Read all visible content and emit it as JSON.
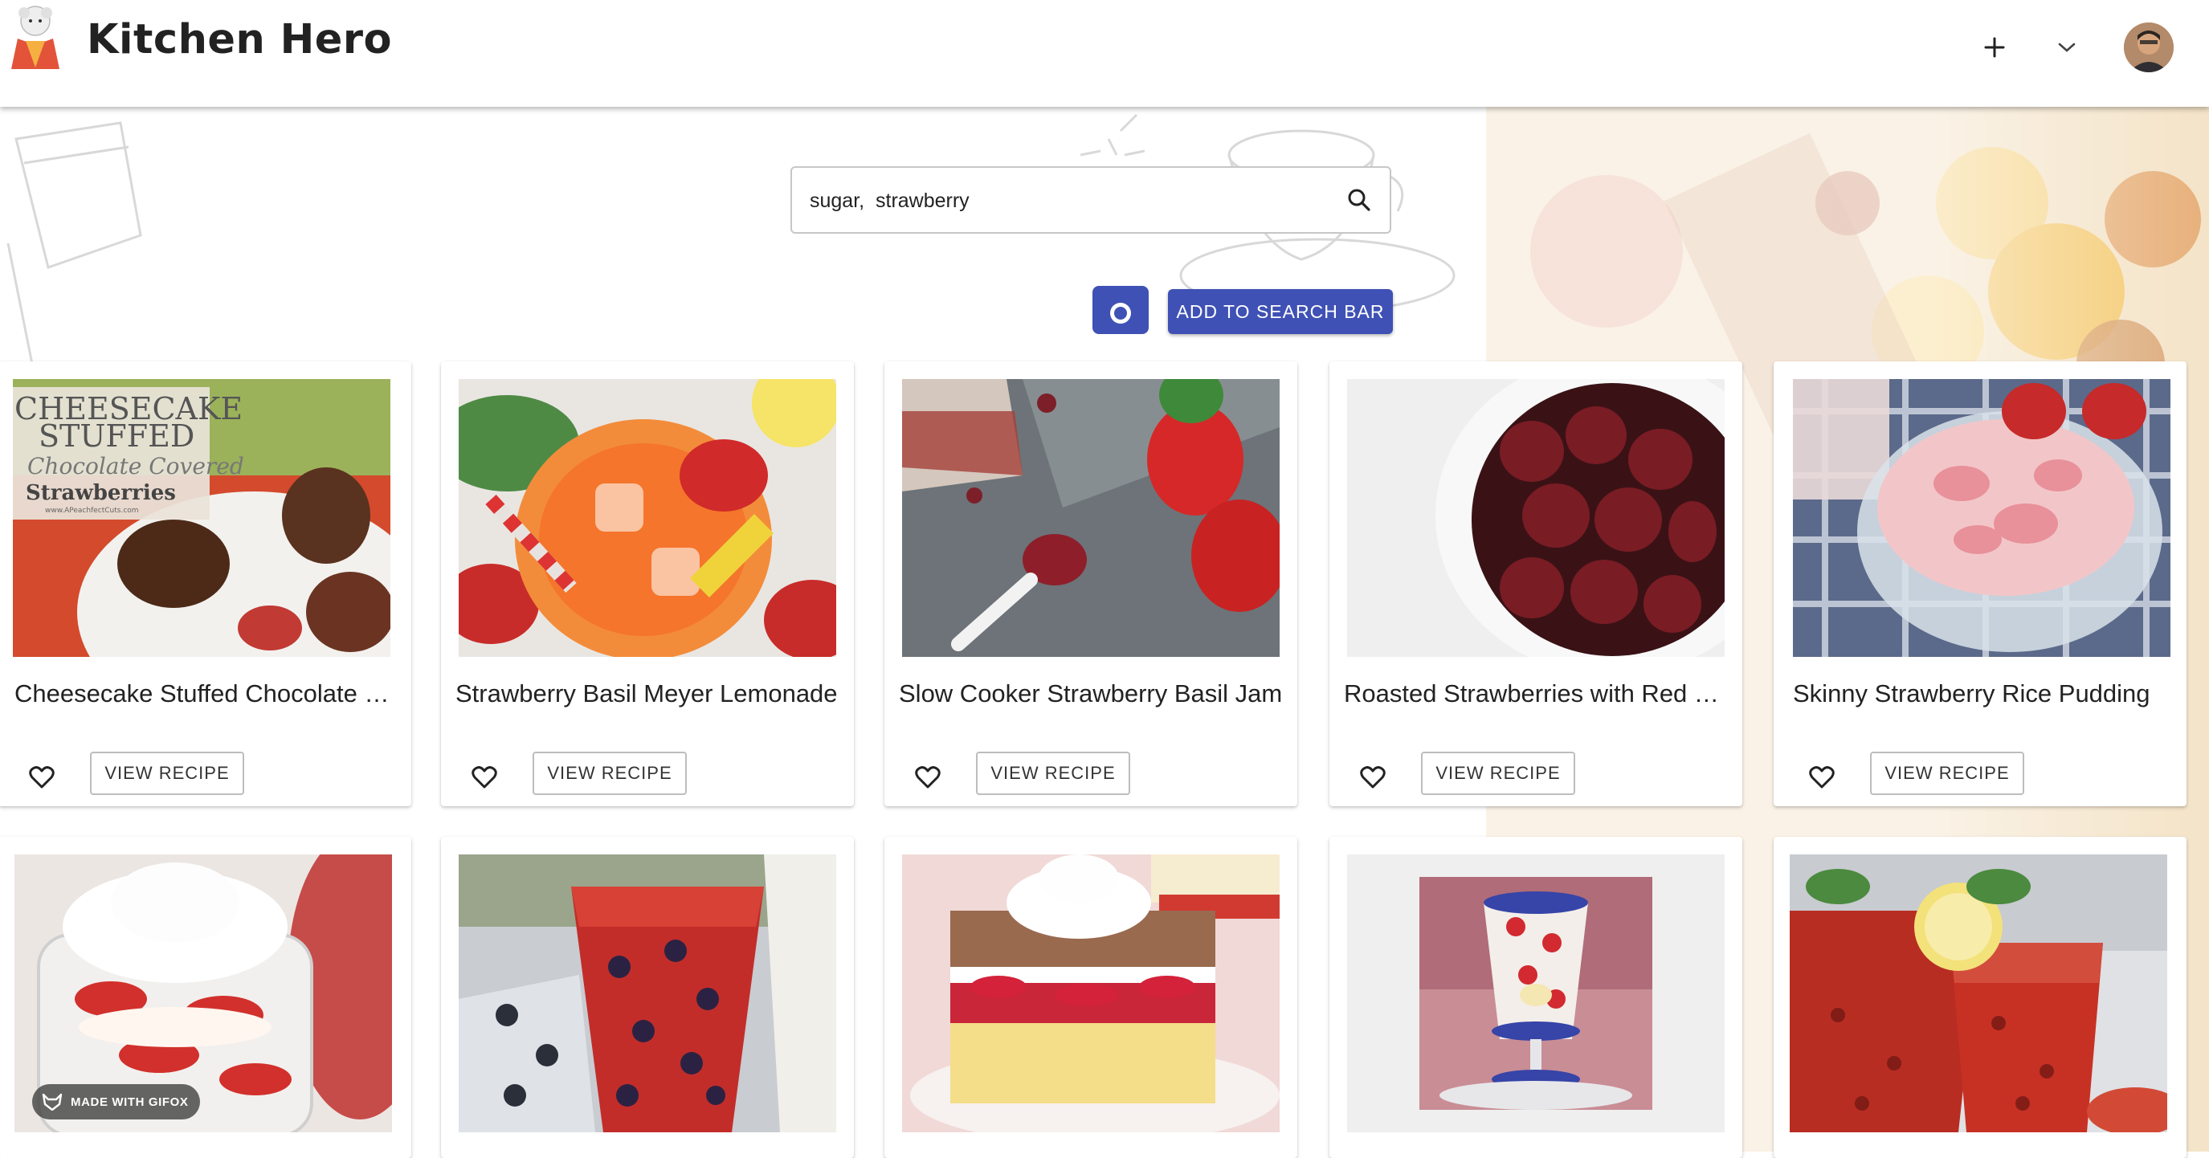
{
  "app": {
    "title": "Kitchen Hero"
  },
  "header": {
    "add_icon": "plus-icon",
    "menu_icon": "chevron-down-icon",
    "avatar": "user-avatar"
  },
  "search": {
    "value": "sugar,  strawberry",
    "icon": "search-icon"
  },
  "actions": {
    "camera_icon": "camera-icon",
    "add_label": "ADD TO SEARCH BAR"
  },
  "colors": {
    "primary": "#3f51b5"
  },
  "recipes": [
    {
      "title": "Cheesecake Stuffed Chocolate Covered Strawberries",
      "action": "VIEW RECIPE",
      "image_text": [
        "CHEESECAKE",
        "STUFFED",
        "Chocolate Covered",
        "Strawberries",
        "www.APeachfectCuts.com"
      ]
    },
    {
      "title": "Strawberry Basil Meyer Lemonade",
      "action": "VIEW RECIPE"
    },
    {
      "title": "Slow Cooker Strawberry Basil Jam",
      "action": "VIEW RECIPE"
    },
    {
      "title": "Roasted Strawberries with Red Wine",
      "action": "VIEW RECIPE"
    },
    {
      "title": "Skinny Strawberry Rice Pudding",
      "action": "VIEW RECIPE"
    }
  ],
  "recipes_row2": [
    {
      "badge": "MADE WITH GIFOX"
    },
    {},
    {},
    {},
    {}
  ]
}
